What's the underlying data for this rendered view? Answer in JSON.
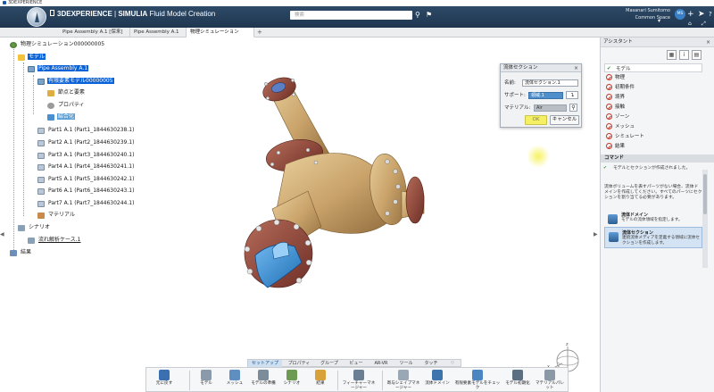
{
  "window_title": "3DEXPERIENCE",
  "header": {
    "brand": "3DEXPERIENCE",
    "separator": " | ",
    "vendor": "SIMULIA",
    "app": " Fluid Model Creation",
    "search_placeholder": "検索",
    "user_name": "Masanari Sumitomo",
    "user_space": "Common Space",
    "avatar_initials": "MS"
  },
  "tabs": [
    {
      "label": "Pipe Assembly A.1 [保来]"
    },
    {
      "label": "Pipe Assembly A.1"
    },
    {
      "label": "物理シミュレーション00000"
    }
  ],
  "tree": {
    "root": "物理シミュレーション000000005",
    "model": "モデル",
    "pipe_asm": "Pipe Assembly A.1",
    "fluid_model": "有限要素モデル00000005",
    "nodes": "節点と要素",
    "properties": "プロパティ",
    "mesh": "結合化",
    "parts": [
      "Part1 A.1 (Part1_1844630238.1)",
      "Part2 A.1 (Part2_1844630239.1)",
      "Part3 A.1 (Part3_1844630240.1)",
      "Part4 A.1 (Part4_1844630241.1)",
      "Part5 A.1 (Part5_1844630242.1)",
      "Part6 A.1 (Part6_1844630243.1)",
      "Part7 A.1 (Part7_1844630244.1)"
    ],
    "material": "マテリアル",
    "scenario": "シナリオ",
    "case": "流れ解析ケース.1",
    "results": "結果"
  },
  "dialog": {
    "title": "流体セクション",
    "name_label": "名前:",
    "name_value": "流体セクション.1",
    "support_label": "サポート:",
    "support_value": "領域.1",
    "material_label": "マテリアル:",
    "material_value": "Air",
    "ok": "OK",
    "cancel": "キャンセル"
  },
  "assistant": {
    "title": "アシスタント",
    "steps": [
      "モデル",
      "物理",
      "初期条件",
      "境界",
      "接触",
      "ゾーン",
      "メッシュ",
      "シミュレート",
      "結果"
    ],
    "command_header": "コマンド",
    "message": "モデルとセクションが作成されました。",
    "desc": "流体ボリュームを表すパーツがない場合、流体ドメインを作成してください。すべてのパーツにセクションを割り当てる必要があります。",
    "cards": [
      {
        "title": "流体ドメイン",
        "desc": "モデルの流体領域を指定します。"
      },
      {
        "title": "流体セクション",
        "desc": "連続流体メディアを定義する領域に流体セクションを作成します。"
      }
    ]
  },
  "section_tabs": [
    "セットアップ",
    "プロパティ",
    "グループ",
    "ビュー",
    "AR-VR",
    "ツール",
    "タッチ"
  ],
  "actions": [
    {
      "label": "元に戻す",
      "color": "#3b6fb0"
    },
    {
      "label": "モデル",
      "color": "#8a9aaa"
    },
    {
      "label": "メッシュ",
      "color": "#5f8fc0"
    },
    {
      "label": "モデルの準備",
      "color": "#7d8c9b"
    },
    {
      "label": "シナリオ",
      "color": "#6f9a52"
    },
    {
      "label": "結果",
      "color": "#d9a13a"
    },
    {
      "label": "フィーチャーマネージャー",
      "color": "#6a7f94"
    },
    {
      "label": "寄与シェイプマネージャー",
      "color": "#9aa7b4"
    },
    {
      "label": "流体ドメイン",
      "color": "#3d74ab"
    },
    {
      "label": "有限要素モデルをチェック",
      "color": "#4b86c2"
    },
    {
      "label": "モデル初期化",
      "color": "#5b6e82"
    },
    {
      "label": "マテリアルパレット",
      "color": "#8b98a6"
    }
  ]
}
